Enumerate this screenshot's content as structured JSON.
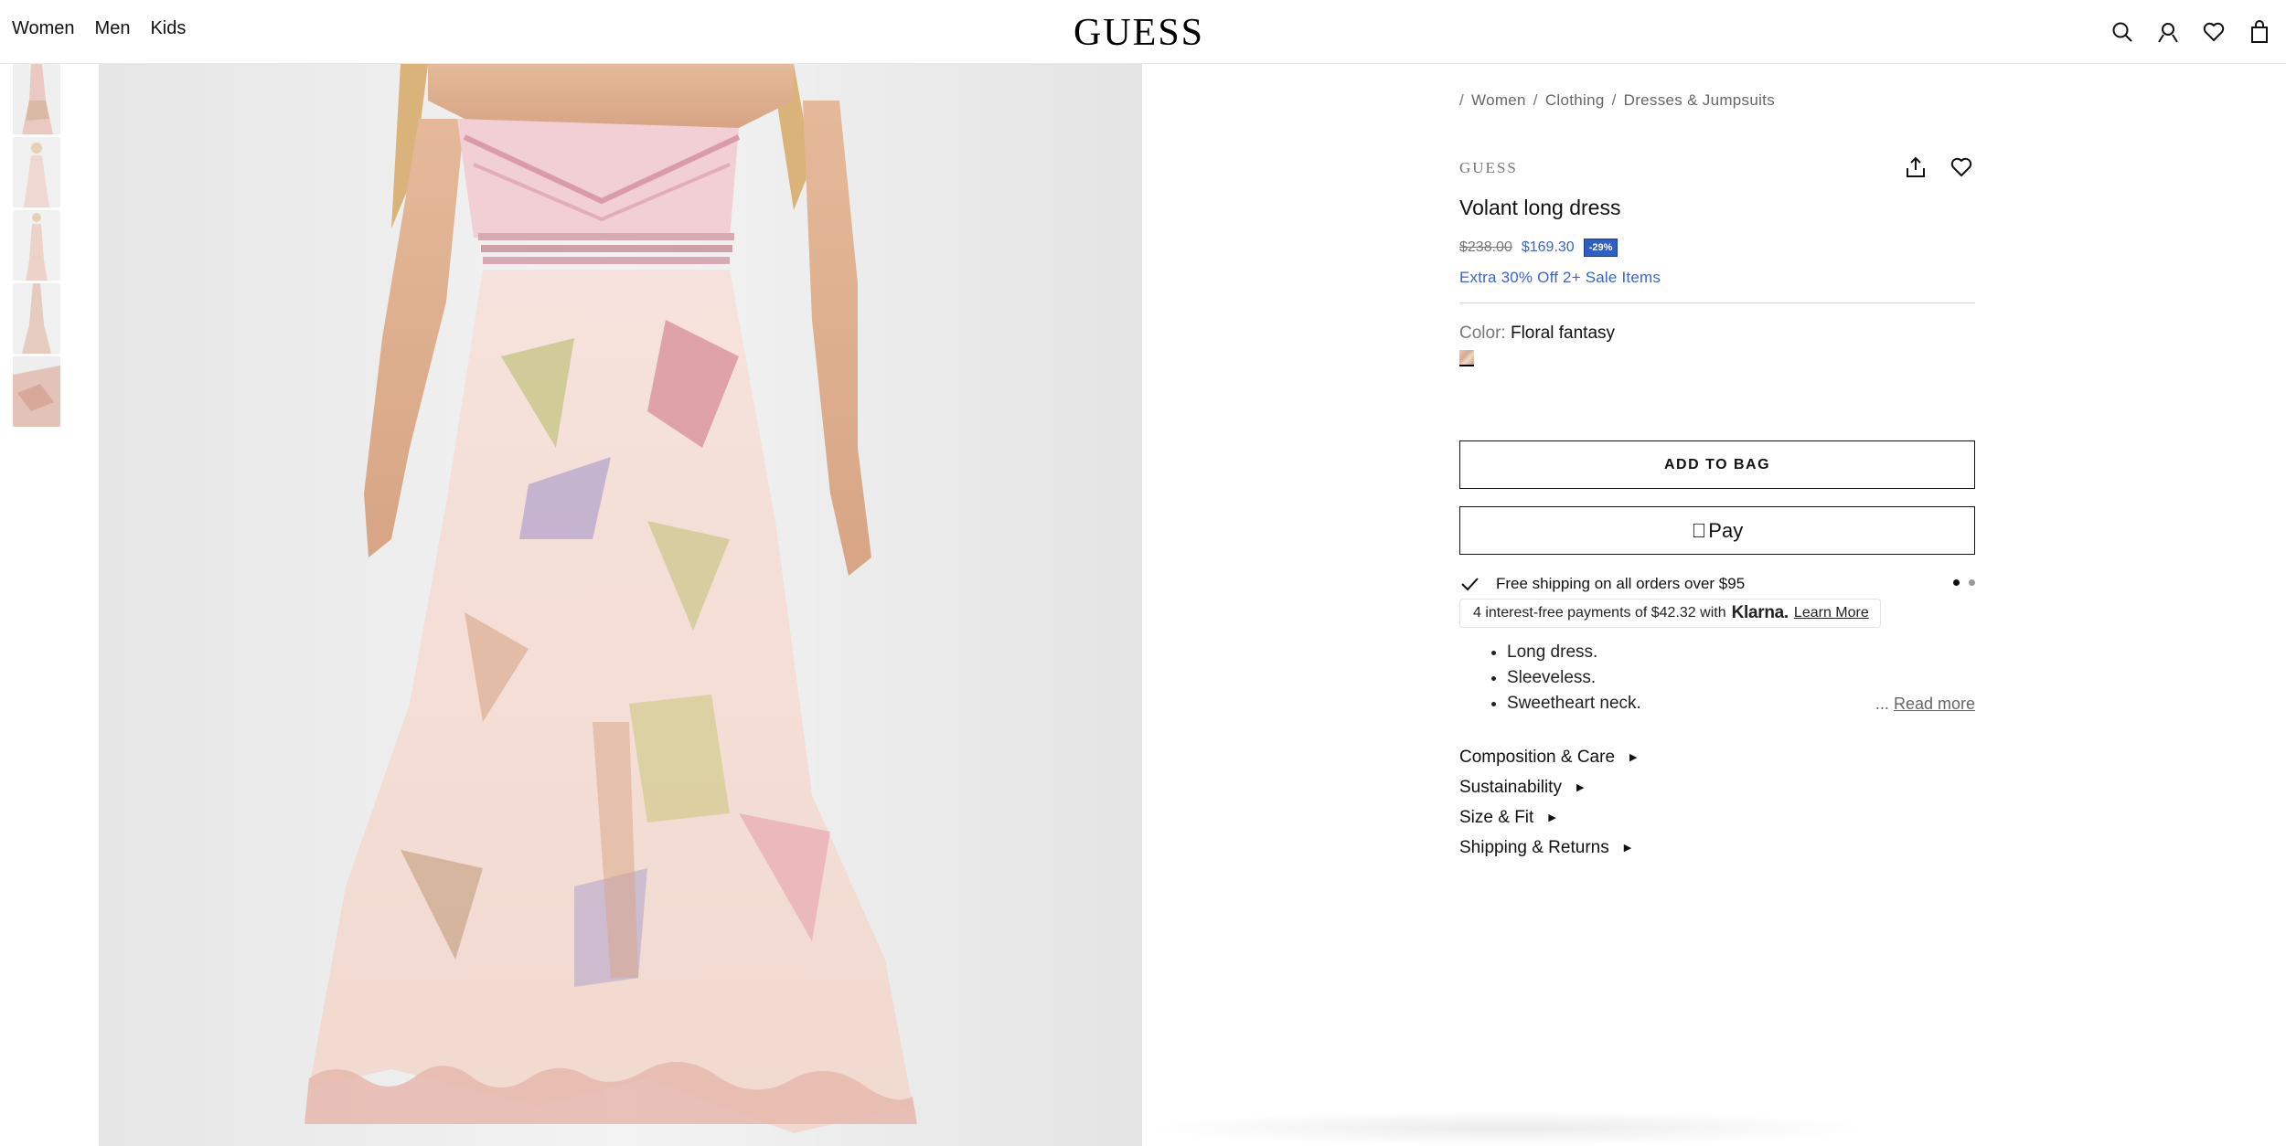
{
  "header": {
    "nav": [
      "Women",
      "Men",
      "Kids"
    ],
    "logo": "GUESS",
    "icons": [
      "search-icon",
      "account-icon",
      "wishlist-icon",
      "bag-icon"
    ]
  },
  "gallery": {
    "thumbnails": 5,
    "main_image_alt": "Volant long dress"
  },
  "product": {
    "breadcrumb": [
      "Women",
      "Clothing",
      "Dresses & Jumpsuits"
    ],
    "brand": "GUESS",
    "title": "Volant long dress",
    "price_original": "$238.00",
    "price_sale": "$169.30",
    "discount_badge": "-29%",
    "promo": "Extra 30% Off 2+ Sale Items",
    "color_label": "Color:",
    "color_value": "Floral fantasy",
    "add_to_bag": "ADD TO BAG",
    "apple_pay": "Pay",
    "shipping": "Free shipping on all orders over $95",
    "klarna_text": "4 interest-free payments of $42.32 with",
    "klarna_brand": "Klarna.",
    "klarna_link": "Learn More",
    "bullets": [
      "Long dress.",
      "Sleeveless.",
      "Sweetheart neck."
    ],
    "read_more_ellipsis": "...",
    "read_more": "Read more",
    "accordion": [
      "Composition & Care",
      "Sustainability",
      "Size & Fit",
      "Shipping & Returns"
    ]
  },
  "colors": {
    "accent_blue": "#3a64c8",
    "badge_blue": "#2f5fc4"
  }
}
